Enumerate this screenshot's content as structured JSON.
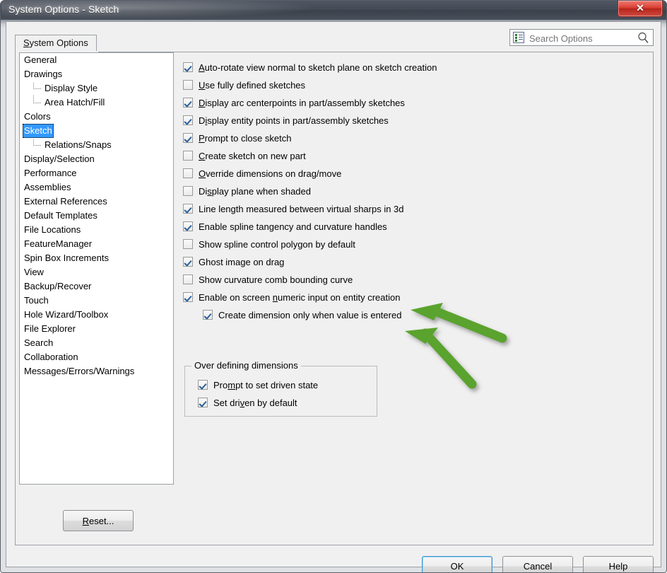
{
  "window": {
    "title": "System Options - Sketch",
    "close_label": "Close"
  },
  "search": {
    "placeholder": "Search Options",
    "value": "",
    "icon": "options-list-icon",
    "button_icon": "search-magnifier-icon"
  },
  "tabs": [
    {
      "label": "System Options",
      "accel": "S",
      "rest": "ystem Options",
      "selected": true
    }
  ],
  "tree": {
    "items": [
      {
        "label": "General",
        "level": 0,
        "selected": false
      },
      {
        "label": "Drawings",
        "level": 0,
        "selected": false
      },
      {
        "label": "Display Style",
        "level": 1,
        "selected": false,
        "first": true
      },
      {
        "label": "Area Hatch/Fill",
        "level": 1,
        "selected": false
      },
      {
        "label": "Colors",
        "level": 0,
        "selected": false
      },
      {
        "label": "Sketch",
        "level": 0,
        "selected": true
      },
      {
        "label": "Relations/Snaps",
        "level": 1,
        "selected": false,
        "first": true
      },
      {
        "label": "Display/Selection",
        "level": 0,
        "selected": false
      },
      {
        "label": "Performance",
        "level": 0,
        "selected": false
      },
      {
        "label": "Assemblies",
        "level": 0,
        "selected": false
      },
      {
        "label": "External References",
        "level": 0,
        "selected": false
      },
      {
        "label": "Default Templates",
        "level": 0,
        "selected": false
      },
      {
        "label": "File Locations",
        "level": 0,
        "selected": false
      },
      {
        "label": "FeatureManager",
        "level": 0,
        "selected": false
      },
      {
        "label": "Spin Box Increments",
        "level": 0,
        "selected": false
      },
      {
        "label": "View",
        "level": 0,
        "selected": false
      },
      {
        "label": "Backup/Recover",
        "level": 0,
        "selected": false
      },
      {
        "label": "Touch",
        "level": 0,
        "selected": false
      },
      {
        "label": "Hole Wizard/Toolbox",
        "level": 0,
        "selected": false
      },
      {
        "label": "File Explorer",
        "level": 0,
        "selected": false
      },
      {
        "label": "Search",
        "level": 0,
        "selected": false
      },
      {
        "label": "Collaboration",
        "level": 0,
        "selected": false
      },
      {
        "label": "Messages/Errors/Warnings",
        "level": 0,
        "selected": false
      }
    ]
  },
  "options": [
    {
      "name": "auto-rotate-view",
      "pre": "",
      "accel": "A",
      "post": "uto-rotate view normal to sketch plane on sketch creation",
      "checked": true,
      "indented": false
    },
    {
      "name": "use-fully-defined-sketches",
      "pre": "",
      "accel": "U",
      "post": "se fully defined sketches",
      "checked": false,
      "indented": false
    },
    {
      "name": "display-arc-centerpoints",
      "pre": "",
      "accel": "D",
      "post": "isplay arc centerpoints in part/assembly sketches",
      "checked": true,
      "indented": false
    },
    {
      "name": "display-entity-points",
      "pre": "D",
      "accel": "i",
      "post": "splay entity points in part/assembly sketches",
      "checked": true,
      "indented": false
    },
    {
      "name": "prompt-to-close-sketch",
      "pre": "",
      "accel": "P",
      "post": "rompt to close sketch",
      "checked": true,
      "indented": false
    },
    {
      "name": "create-sketch-on-new-part",
      "pre": "",
      "accel": "C",
      "post": "reate sketch on new part",
      "checked": false,
      "indented": false
    },
    {
      "name": "override-dimensions-drag",
      "pre": "",
      "accel": "O",
      "post": "verride dimensions on drag/move",
      "checked": false,
      "indented": false
    },
    {
      "name": "display-plane-when-shaded",
      "pre": "Di",
      "accel": "s",
      "post": "play plane when shaded",
      "checked": false,
      "indented": false
    },
    {
      "name": "line-length-virtual-sharps",
      "pre": "Line length measured between virtual sharps in 3d",
      "accel": "",
      "post": "",
      "checked": true,
      "indented": false
    },
    {
      "name": "enable-spline-tangency",
      "pre": "Enable spline tangency and curvature handles",
      "accel": "",
      "post": "",
      "checked": true,
      "indented": false
    },
    {
      "name": "show-spline-control-polygon",
      "pre": "Show spline control polygon by default",
      "accel": "",
      "post": "",
      "checked": false,
      "indented": false
    },
    {
      "name": "ghost-image-on-drag",
      "pre": "Ghost image on drag",
      "accel": "",
      "post": "",
      "checked": true,
      "indented": false
    },
    {
      "name": "show-curvature-comb",
      "pre": "Show curvature comb bounding curve",
      "accel": "",
      "post": "",
      "checked": false,
      "indented": false
    },
    {
      "name": "enable-on-screen-numeric",
      "pre": "Enable on screen ",
      "accel": "n",
      "post": "umeric input on entity creation",
      "checked": true,
      "indented": false
    },
    {
      "name": "create-dimension-on-value",
      "pre": "Create dimension only when value is entered",
      "accel": "",
      "post": "",
      "checked": true,
      "indented": true
    }
  ],
  "group_over_defining": {
    "legend_pre": "Over definin",
    "legend_accel": "g",
    "legend_post": " dimensions",
    "rows": [
      {
        "name": "prompt-to-set-driven-state",
        "pre": "Pro",
        "accel": "m",
        "post": "pt to set driven state",
        "checked": true
      },
      {
        "name": "set-driven-by-default",
        "pre": "Set dri",
        "accel": "v",
        "post": "en by default",
        "checked": true
      }
    ]
  },
  "buttons": {
    "reset": {
      "pre": "",
      "accel": "R",
      "post": "eset..."
    },
    "ok": {
      "label": "OK"
    },
    "cancel": {
      "label": "Cancel"
    },
    "help": {
      "label": "Help"
    }
  },
  "annotations": {
    "arrows": [
      {
        "name": "green-arrow-upper",
        "color": "#5aa32e"
      },
      {
        "name": "green-arrow-lower",
        "color": "#5aa32e"
      }
    ]
  },
  "colors": {
    "accent": "#3399ff",
    "annotation_green": "#5aa32e",
    "titlebar": "#3d4450",
    "close_red": "#d93f33",
    "panel_bg": "#f0f0f0"
  }
}
